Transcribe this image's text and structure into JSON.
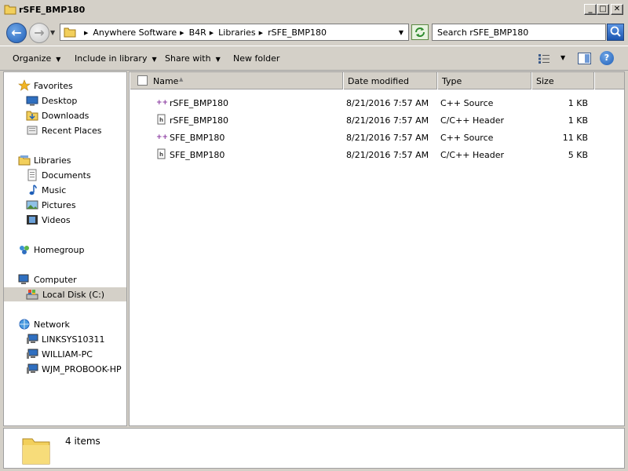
{
  "window": {
    "title": "rSFE_BMP180"
  },
  "address": {
    "crumbs": [
      "Anywhere Software",
      "B4R",
      "Libraries",
      "rSFE_BMP180"
    ]
  },
  "search": {
    "placeholder": "Search rSFE_BMP180"
  },
  "toolbar": {
    "organize": "Organize",
    "include_in_library": "Include in library",
    "share_with": "Share with",
    "new_folder": "New folder"
  },
  "nav": {
    "favorites": "Favorites",
    "desktop": "Desktop",
    "downloads": "Downloads",
    "recent_places": "Recent Places",
    "libraries": "Libraries",
    "documents": "Documents",
    "music": "Music",
    "pictures": "Pictures",
    "videos": "Videos",
    "homegroup": "Homegroup",
    "computer": "Computer",
    "local_disk": "Local Disk (C:)",
    "network": "Network",
    "net1": "LINKSYS10311",
    "net2": "WILLIAM-PC",
    "net3": "WJM_PROBOOK-HP"
  },
  "columns": {
    "name": "Name",
    "date_modified": "Date modified",
    "type": "Type",
    "size": "Size"
  },
  "files": [
    {
      "name": "rSFE_BMP180",
      "date": "8/21/2016 7:57 AM",
      "type": "C++ Source",
      "size": "1 KB",
      "icon": "cpp-source-icon"
    },
    {
      "name": "rSFE_BMP180",
      "date": "8/21/2016 7:57 AM",
      "type": "C/C++ Header",
      "size": "1 KB",
      "icon": "c-header-icon"
    },
    {
      "name": "SFE_BMP180",
      "date": "8/21/2016 7:57 AM",
      "type": "C++ Source",
      "size": "11 KB",
      "icon": "cpp-source-icon"
    },
    {
      "name": "SFE_BMP180",
      "date": "8/21/2016 7:57 AM",
      "type": "C/C++ Header",
      "size": "5 KB",
      "icon": "c-header-icon"
    }
  ],
  "details": {
    "item_count": "4 items"
  },
  "colors": {
    "selection_bg": "#d4d0c8",
    "folder_yellow": "#f2cf5b",
    "accent_blue": "#1f5fb8"
  }
}
